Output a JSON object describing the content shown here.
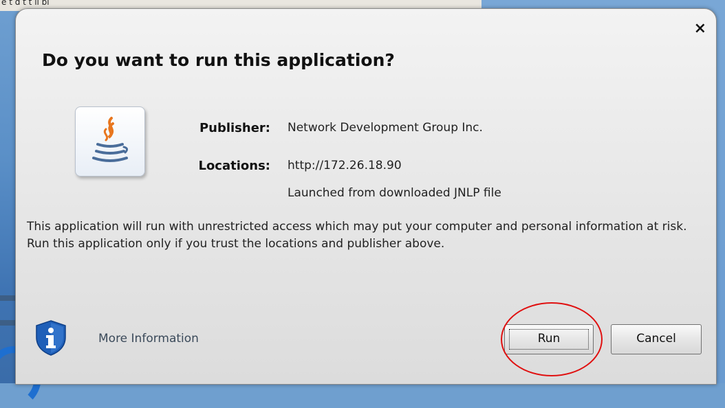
{
  "background": {
    "window_text": "e          t     d  t  t      il bl"
  },
  "dialog": {
    "title": "Do you want to run this application?",
    "close_glyph": "×",
    "publisher_label": "Publisher:",
    "publisher_value": "Network Development Group Inc.",
    "locations_label": "Locations:",
    "location_value": "http://172.26.18.90",
    "launched_text": "Launched from downloaded JNLP file",
    "warning_text": "This application will run with unrestricted access which may put your computer and personal information at risk. Run this application only if you trust the locations and publisher above.",
    "more_info_label": "More Information",
    "run_label": "Run",
    "cancel_label": "Cancel",
    "icons": {
      "app": "java-icon",
      "info": "info-shield-icon"
    }
  },
  "colors": {
    "highlight_ring": "#e01010",
    "shield_blue": "#1f5fb8"
  }
}
